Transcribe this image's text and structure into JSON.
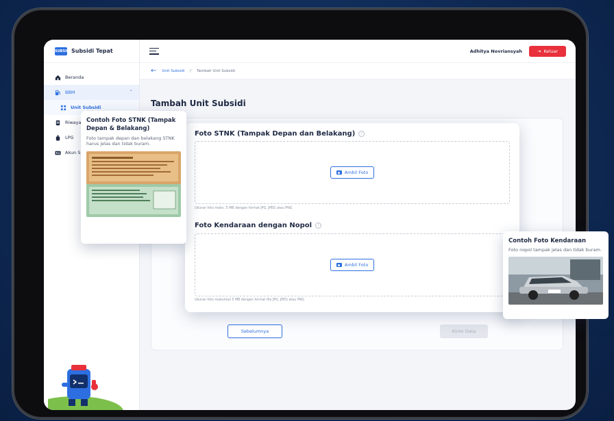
{
  "brand": {
    "logo_text": "SUBSIDI",
    "name": "Subsidi Tepat"
  },
  "sidebar": {
    "items": [
      {
        "label": "Beranda"
      },
      {
        "label": "BBM"
      },
      {
        "label": "Unit Subsidi"
      },
      {
        "label": "Riwayat"
      },
      {
        "label": "LPG"
      },
      {
        "label": "Akun Saya"
      }
    ]
  },
  "header": {
    "user_name": "Adhitya Novriansyah",
    "logout_label": "Keluar"
  },
  "breadcrumb": {
    "parent": "Unit Subsidi",
    "separator": "/",
    "current": "Tambah Unit Subsidi"
  },
  "page": {
    "title": "Tambah Unit Subsidi"
  },
  "upload": {
    "stnk_title": "Foto STNK (Tampak Depan dan Belakang)",
    "stnk_button": "Ambil Foto",
    "stnk_hint": "Ukuran foto maks. 5 MB dengan format JPG, JPEG atau PNG",
    "kendaraan_title": "Foto Kendaraan dengan Nopol",
    "kendaraan_button": "Ambil Foto",
    "kendaraan_hint": "Ukuran foto maksimal 5 MB dengan format file JPG, JPEG atau PNG"
  },
  "buttons": {
    "prev": "Sebelumnya",
    "next": "Kirim Data"
  },
  "tooltips": {
    "stnk": {
      "title": "Contoh Foto STNK (Tampak Depan & Belakang)",
      "desc": "Foto tampak depan dan belakang STNK harus jelas dan tidak buram."
    },
    "kendaraan": {
      "title": "Contoh Foto Kendaraan",
      "desc": "Foto nopol tampak jelas dan tidak buram."
    }
  },
  "colors": {
    "primary": "#2d6fe0",
    "danger": "#e8313b",
    "background": "#0f2a55"
  }
}
